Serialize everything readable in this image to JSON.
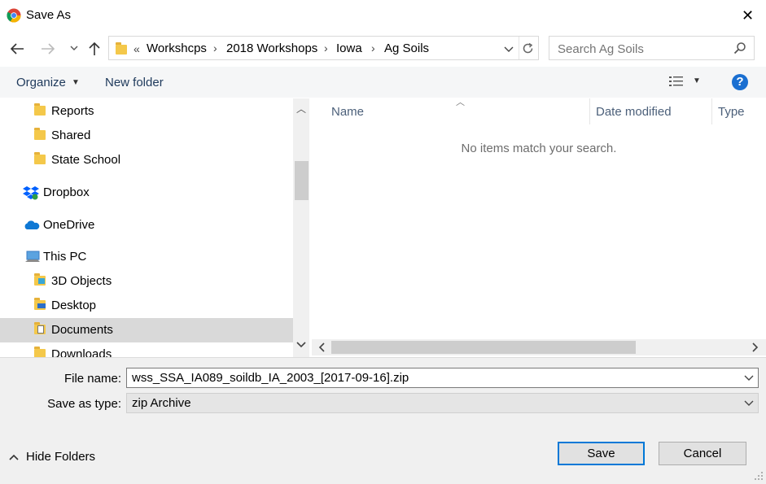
{
  "window": {
    "title": "Save As",
    "close_glyph": "✕",
    "app_icon": "chrome-icon"
  },
  "address": {
    "back_icon": "back-arrow-icon",
    "forward_icon": "forward-arrow-icon",
    "up_icon": "up-arrow-icon",
    "overflow_glyph": "«",
    "breadcrumbs": [
      "Workshcps",
      "2018 Workshops",
      "Iowa",
      "Ag Soils"
    ],
    "search_placeholder": "Search Ag Soils"
  },
  "toolbar": {
    "organize_label": "Organize",
    "new_folder_label": "New folder",
    "help_glyph": "?"
  },
  "nav": {
    "items": [
      {
        "label": "Reports",
        "icon": "folder-icon"
      },
      {
        "label": "Shared",
        "icon": "folder-icon"
      },
      {
        "label": "State School",
        "icon": "folder-icon"
      },
      {
        "label": "Dropbox",
        "icon": "dropbox-icon"
      },
      {
        "label": "OneDrive",
        "icon": "onedrive-icon"
      },
      {
        "label": "This PC",
        "icon": "computer-icon"
      },
      {
        "label": "3D Objects",
        "icon": "3d-objects-icon"
      },
      {
        "label": "Desktop",
        "icon": "desktop-folder-icon"
      },
      {
        "label": "Documents",
        "icon": "documents-folder-icon",
        "selected": true
      },
      {
        "label": "Downloads",
        "icon": "downloads-folder-icon"
      }
    ]
  },
  "files": {
    "columns": [
      "Name",
      "Date modified",
      "Type"
    ],
    "empty_message": "No items match your search."
  },
  "form": {
    "file_name_label": "File name:",
    "file_name_value": "wss_SSA_IA089_soildb_IA_2003_[2017-09-16].zip",
    "save_type_label": "Save as type:",
    "save_type_value": "zip Archive"
  },
  "actions": {
    "hide_folders_label": "Hide Folders",
    "save_label": "Save",
    "cancel_label": "Cancel"
  }
}
